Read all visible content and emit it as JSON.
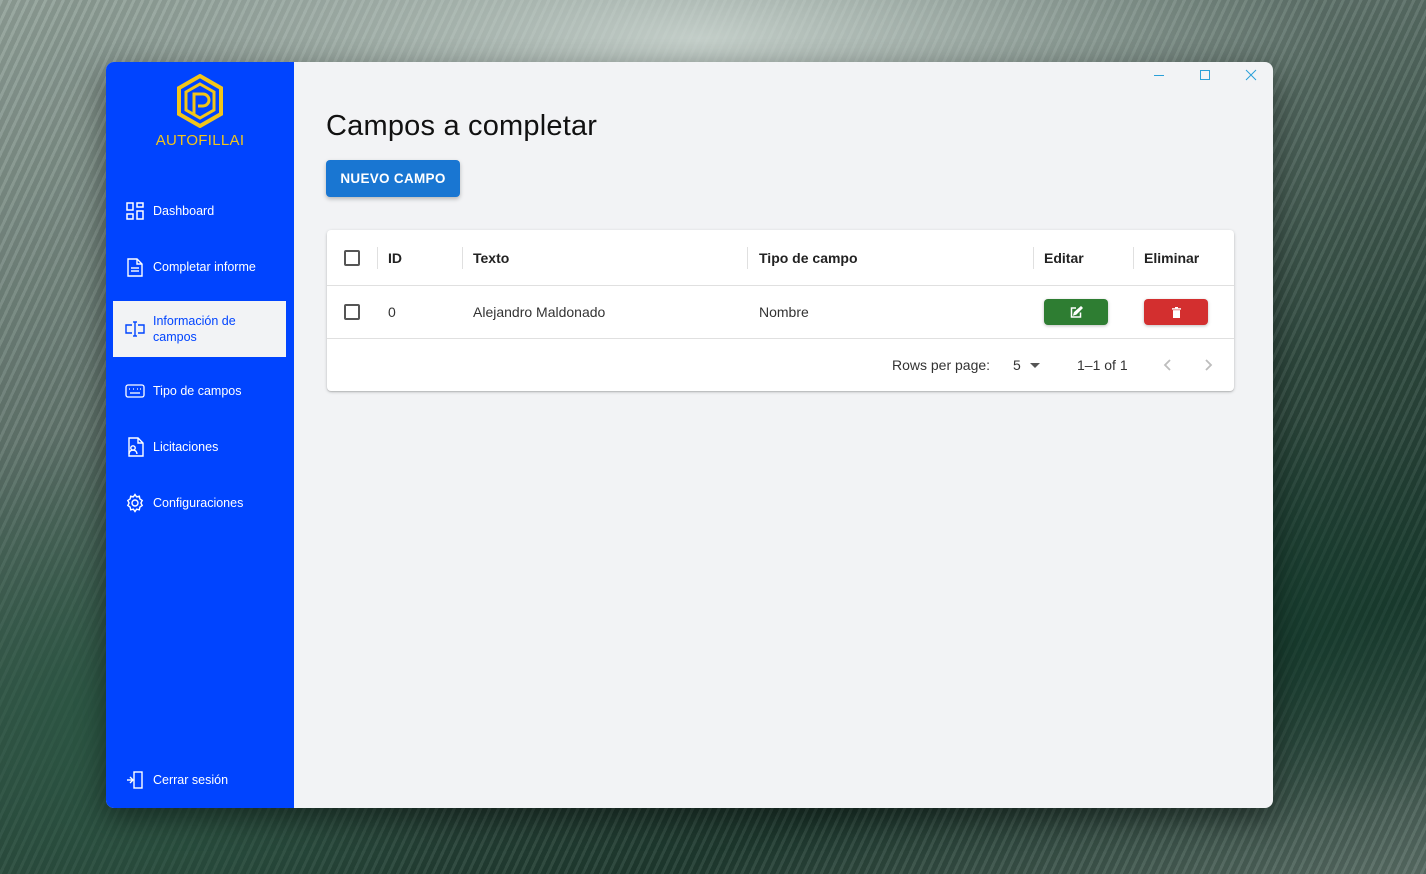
{
  "brand": {
    "name": "AUTOFILLAI",
    "logo_icon": "hexagon-logo-icon",
    "color": "#f2c51a"
  },
  "sidebar": {
    "background": "#0044ff",
    "items": [
      {
        "label": "Dashboard",
        "icon": "dashboard-icon"
      },
      {
        "label": "Completar informe",
        "icon": "document-icon"
      },
      {
        "label": "Información de campos",
        "icon": "text-field-icon",
        "active": true
      },
      {
        "label": "Tipo de campos",
        "icon": "keyboard-icon"
      },
      {
        "label": "Licitaciones",
        "icon": "contact-document-icon"
      },
      {
        "label": "Configuraciones",
        "icon": "gear-icon"
      }
    ],
    "logout": {
      "label": "Cerrar sesión",
      "icon": "logout-icon"
    }
  },
  "window_controls": {
    "minimize": "minimize-icon",
    "maximize": "maximize-icon",
    "close": "close-icon"
  },
  "main": {
    "title": "Campos a completar",
    "new_button": "NUEVO CAMPO",
    "table": {
      "columns": [
        "ID",
        "Texto",
        "Tipo de campo",
        "Editar",
        "Eliminar"
      ],
      "rows": [
        {
          "id": "0",
          "texto": "Alejandro Maldonado",
          "tipo": "Nombre"
        }
      ],
      "footer": {
        "rows_per_page_label": "Rows per page:",
        "rows_per_page_value": "5",
        "range": "1–1 of 1"
      }
    }
  },
  "colors": {
    "accent": "#1976d2",
    "edit": "#2e7d32",
    "delete": "#d32f2f"
  }
}
